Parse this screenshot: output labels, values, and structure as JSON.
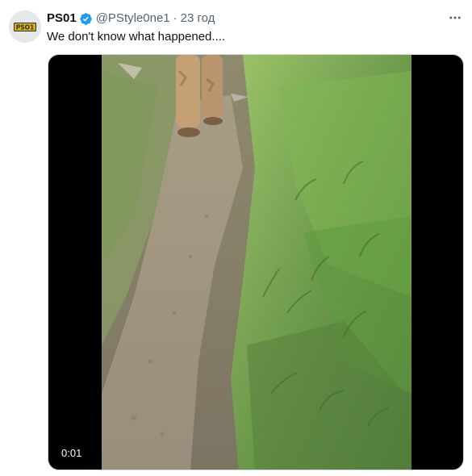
{
  "tweet": {
    "display_name": "PS01",
    "handle": "@PStyle0ne1",
    "separator": "·",
    "time": "23 год",
    "text": "We don't know what happened....",
    "avatar_logo_text": "PSO1",
    "verified_icon": "verified-badge-icon",
    "more_icon": "more-dots-icon",
    "colors": {
      "verified": "#1d9bf0",
      "secondary_text": "#536471",
      "primary_text": "#0f1419",
      "avatar_logo": "#d9b310"
    }
  },
  "video": {
    "duration": "0:01",
    "scene": "dirt path beside green grass, person walking ahead"
  }
}
